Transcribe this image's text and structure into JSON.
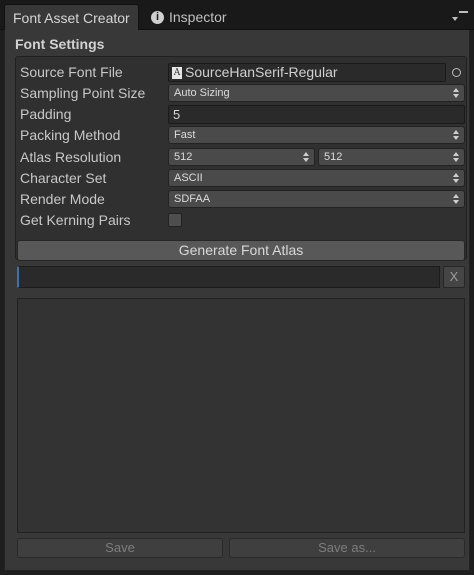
{
  "tabs": {
    "active": "Font Asset Creator",
    "inactive": "Inspector",
    "info_glyph": "i"
  },
  "section": {
    "title": "Font Settings"
  },
  "fields": {
    "source_font_file": {
      "label": "Source Font File",
      "value": "SourceHanSerif-Regular",
      "icon_glyph": "A"
    },
    "sampling_point_size": {
      "label": "Sampling Point Size",
      "value": "Auto Sizing"
    },
    "padding": {
      "label": "Padding",
      "value": "5"
    },
    "packing_method": {
      "label": "Packing Method",
      "value": "Fast"
    },
    "atlas_resolution": {
      "label": "Atlas Resolution",
      "width": "512",
      "height": "512"
    },
    "character_set": {
      "label": "Character Set",
      "value": "ASCII"
    },
    "render_mode": {
      "label": "Render Mode",
      "value": "SDFAA"
    },
    "get_kerning_pairs": {
      "label": "Get Kerning Pairs",
      "checked": false
    }
  },
  "actions": {
    "generate": "Generate Font Atlas",
    "clear": "X",
    "save": "Save",
    "save_as": "Save as..."
  },
  "icons": [
    "info-icon",
    "tab-menu-icon",
    "font-file-icon",
    "object-picker-icon",
    "dropdown-arrows-icon"
  ],
  "colors": {
    "panel": "#383838",
    "tab_strip": "#191919",
    "focus_accent": "#3f6fb5"
  }
}
